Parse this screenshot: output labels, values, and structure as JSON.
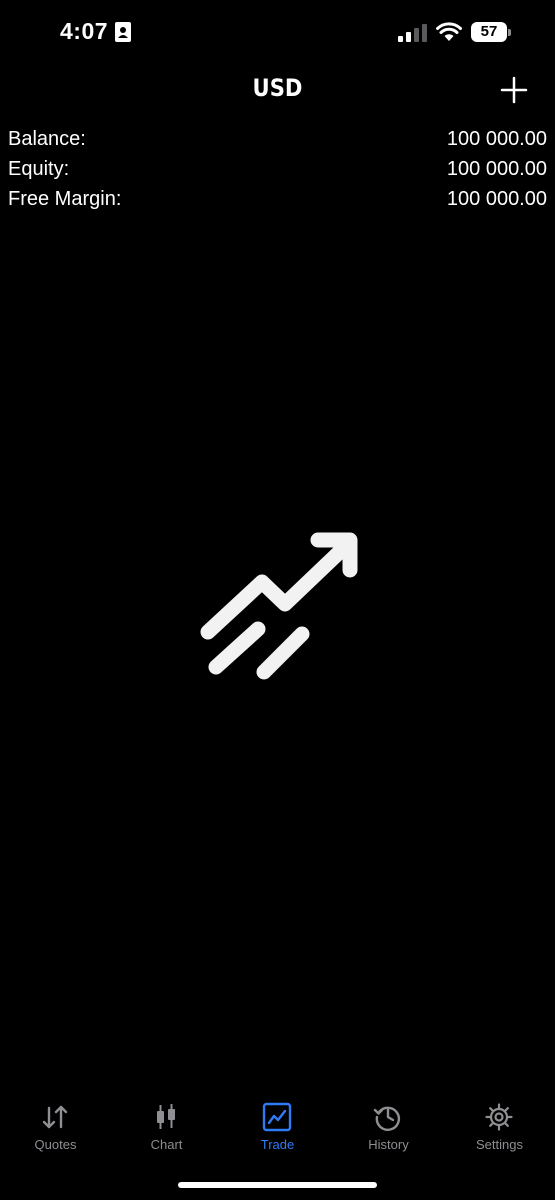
{
  "status_bar": {
    "time": "4:07",
    "battery": "57"
  },
  "header": {
    "title": "USD"
  },
  "account": {
    "rows": [
      {
        "label": "Balance:",
        "value": "100 000.00"
      },
      {
        "label": "Equity:",
        "value": "100 000.00"
      },
      {
        "label": "Free Margin:",
        "value": "100 000.00"
      }
    ]
  },
  "tabs": [
    {
      "label": "Quotes",
      "icon": "quotes-arrows-icon",
      "active": false
    },
    {
      "label": "Chart",
      "icon": "candlestick-icon",
      "active": false
    },
    {
      "label": "Trade",
      "icon": "trade-chart-icon",
      "active": true
    },
    {
      "label": "History",
      "icon": "history-clock-icon",
      "active": false
    },
    {
      "label": "Settings",
      "icon": "gear-icon",
      "active": false
    }
  ],
  "colors": {
    "background": "#000000",
    "text": "#ffffff",
    "accent": "#2f7bf6",
    "inactive": "#8e8e93"
  }
}
